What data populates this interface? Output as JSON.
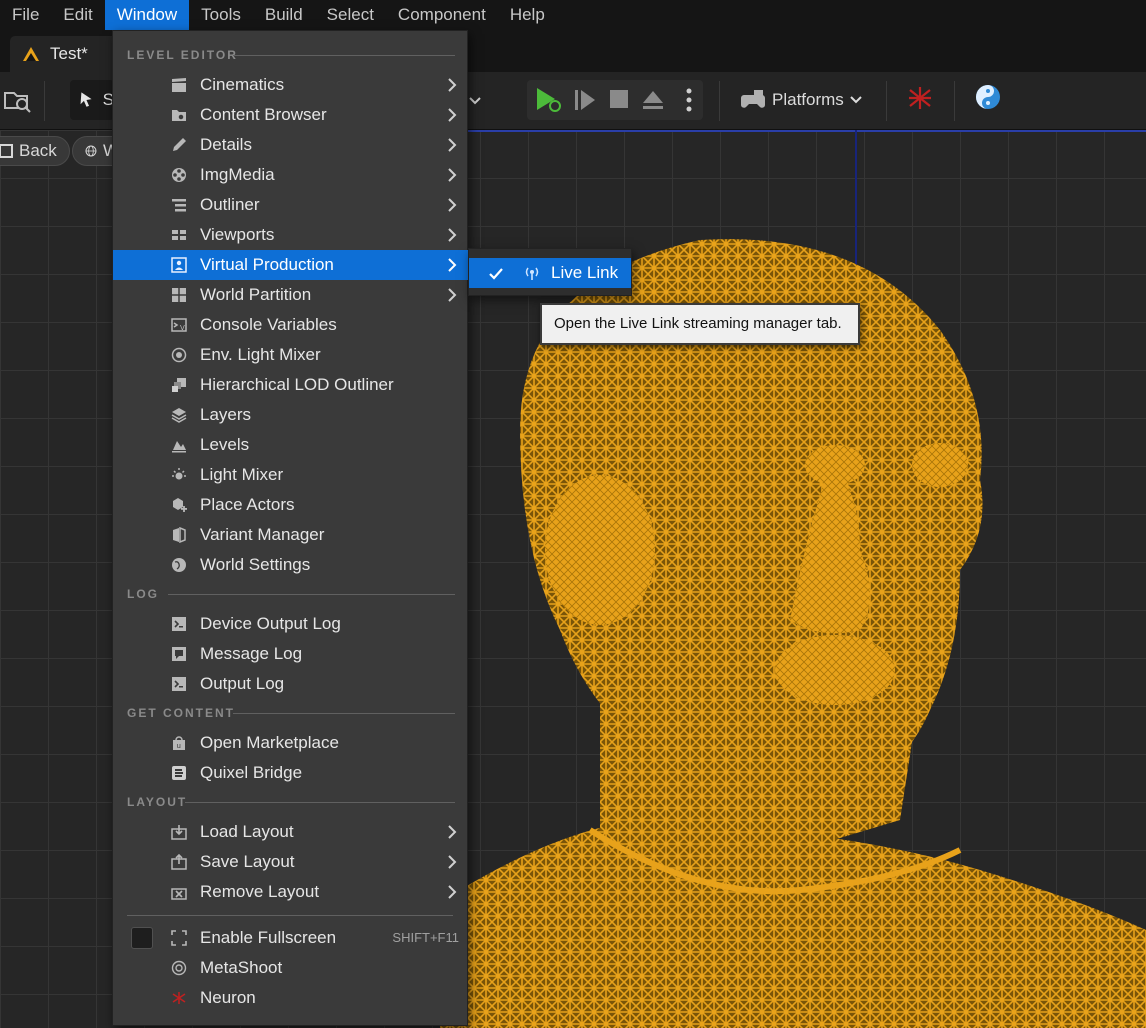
{
  "menubar": {
    "items": [
      "File",
      "Edit",
      "Window",
      "Tools",
      "Build",
      "Select",
      "Component",
      "Help"
    ],
    "active": "Window"
  },
  "document_tab": {
    "title": "Test*"
  },
  "toolbar": {
    "select_mode_partial": "S",
    "platforms_label": "Platforms"
  },
  "viewport": {
    "back_label": "Back",
    "view_label_partial": "W",
    "wireframe_color": "#E8A21A"
  },
  "window_menu": {
    "sections": {
      "level_editor": "LEVEL EDITOR",
      "log": "LOG",
      "get_content": "GET CONTENT",
      "layout": "LAYOUT"
    },
    "level_editor_items": [
      {
        "label": "Cinematics",
        "icon": "clapperboard-icon",
        "submenu": true
      },
      {
        "label": "Content Browser",
        "icon": "folder-search-icon",
        "submenu": true
      },
      {
        "label": "Details",
        "icon": "pencil-icon",
        "submenu": true
      },
      {
        "label": "ImgMedia",
        "icon": "film-reel-icon",
        "submenu": true
      },
      {
        "label": "Outliner",
        "icon": "list-tree-icon",
        "submenu": true
      },
      {
        "label": "Viewports",
        "icon": "viewport-grid-icon",
        "submenu": true
      },
      {
        "label": "Virtual Production",
        "icon": "virtual-production-icon",
        "submenu": true
      },
      {
        "label": "World Partition",
        "icon": "world-partition-icon",
        "submenu": true
      },
      {
        "label": "Console Variables",
        "icon": "console-variables-icon",
        "submenu": false
      },
      {
        "label": "Env. Light Mixer",
        "icon": "env-light-mixer-icon",
        "submenu": false
      },
      {
        "label": "Hierarchical LOD Outliner",
        "icon": "hlod-icon",
        "submenu": false
      },
      {
        "label": "Layers",
        "icon": "layers-icon",
        "submenu": false
      },
      {
        "label": "Levels",
        "icon": "levels-icon",
        "submenu": false
      },
      {
        "label": "Light Mixer",
        "icon": "light-mixer-icon",
        "submenu": false
      },
      {
        "label": "Place Actors",
        "icon": "place-actors-icon",
        "submenu": false
      },
      {
        "label": "Variant Manager",
        "icon": "variant-manager-icon",
        "submenu": false
      },
      {
        "label": "World Settings",
        "icon": "globe-icon",
        "submenu": false
      }
    ],
    "log_items": [
      {
        "label": "Device Output Log",
        "icon": "terminal-icon"
      },
      {
        "label": "Message Log",
        "icon": "message-log-icon"
      },
      {
        "label": "Output Log",
        "icon": "terminal-icon"
      }
    ],
    "get_content_items": [
      {
        "label": "Open Marketplace",
        "icon": "marketplace-icon"
      },
      {
        "label": "Quixel Bridge",
        "icon": "quixel-bridge-icon"
      }
    ],
    "layout_items": [
      {
        "label": "Load Layout",
        "icon": "load-layout-icon",
        "submenu": true
      },
      {
        "label": "Save Layout",
        "icon": "save-layout-icon",
        "submenu": true
      },
      {
        "label": "Remove Layout",
        "icon": "remove-layout-icon",
        "submenu": true
      }
    ],
    "bottom_items": {
      "fullscreen": {
        "label": "Enable Fullscreen",
        "shortcut": "SHIFT+F11",
        "checked": false
      },
      "metashoot": {
        "label": "MetaShoot"
      },
      "neuron": {
        "label": "Neuron"
      }
    },
    "highlighted": "Virtual Production"
  },
  "virtual_production_submenu": {
    "items": [
      {
        "label": "Live Link",
        "checked": true
      }
    ]
  },
  "tooltip": {
    "text": "Open the Live Link streaming manager tab."
  },
  "colors": {
    "accent": "#0E6FD6",
    "menu_bg": "#3A3A3A",
    "wireframe": "#E8A21A"
  }
}
